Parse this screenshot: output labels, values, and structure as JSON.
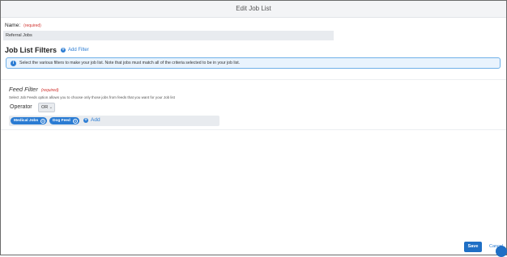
{
  "header": {
    "title": "Edit Job List"
  },
  "name_field": {
    "label": "Name:",
    "required": "(required)",
    "value": "Referral Jobs"
  },
  "filters": {
    "title": "Job List Filters",
    "add_filter_label": "Add Filter",
    "info_text": "Select the various filters to make your job list. Note that jobs must match all of the criteria selected to be in your job list."
  },
  "feed_filter": {
    "title": "Feed Filter",
    "required": "(required)",
    "description": "Select Job Feeds option allows you to choose only those jobs from feeds that you want for your Job list",
    "operator_label": "Operator",
    "operator_value": "OR",
    "tags": [
      "Medical Jobs",
      "Dog Feed"
    ],
    "add_label": "Add"
  },
  "footer": {
    "save_label": "Save",
    "cancel_label": "Cancel"
  },
  "colors": {
    "accent": "#2b7cd3",
    "required": "#d0312d",
    "info_bg": "#e9f3fd"
  },
  "icons": [
    "plus-circle-icon",
    "info-icon",
    "chevron-down-icon",
    "close-circle-icon"
  ]
}
